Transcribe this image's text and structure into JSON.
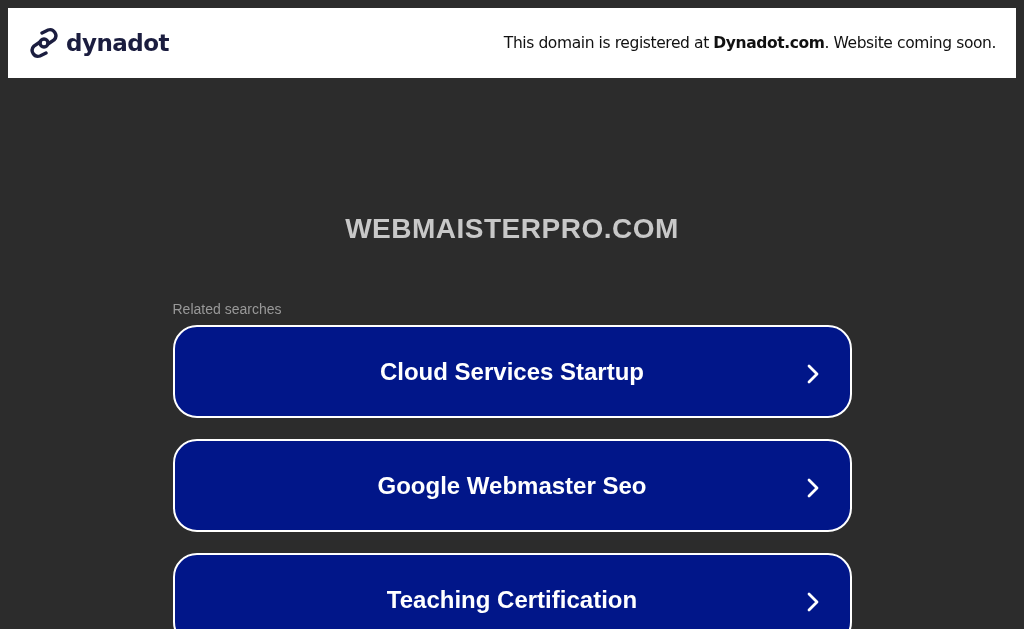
{
  "header": {
    "logo_text": "dynadot",
    "notice": "This domain is registered at **Dynadot.com**. Website coming soon."
  },
  "domain": "WEBMAISTERPRO.COM",
  "related_searches": {
    "label": "Related searches",
    "items": [
      {
        "label": "Cloud Services Startup"
      },
      {
        "label": "Google Webmaster Seo"
      },
      {
        "label": "Teaching Certification"
      }
    ]
  }
}
